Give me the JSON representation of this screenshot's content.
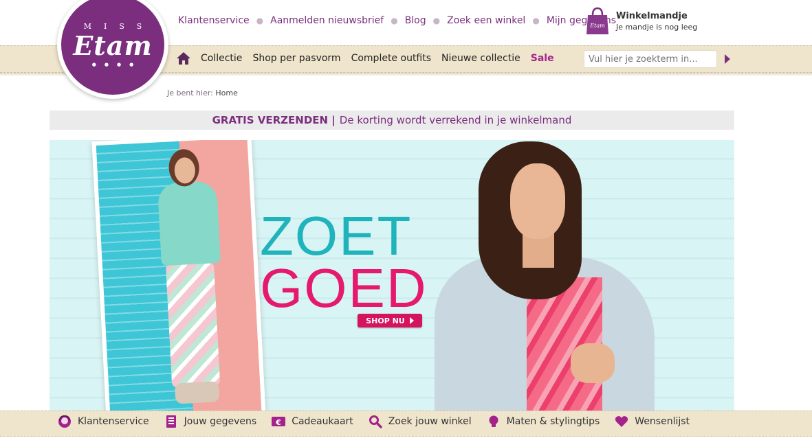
{
  "util_nav": [
    "Klantenservice",
    "Aanmelden nieuwsbrief",
    "Blog",
    "Zoek een winkel",
    "Mijn gegevens"
  ],
  "cart": {
    "title": "Winkelmandje",
    "status": "Je mandje is nog leeg",
    "bag_label": "Etam"
  },
  "logo": {
    "miss": "MISS",
    "brand": "Etam"
  },
  "main_nav": [
    "Collectie",
    "Shop per pasvorm",
    "Complete outfits",
    "Nieuwe collectie"
  ],
  "sale_label": "Sale",
  "search": {
    "placeholder": "Vul hier je zoekterm in..."
  },
  "breadcrumb": {
    "prefix": "Je bent hier:",
    "current": "Home"
  },
  "promo": {
    "strong": "GRATIS VERZENDEN |",
    "text": "De korting wordt verrekend in je winkelmand"
  },
  "hero": {
    "line1": "ZOET",
    "line2": "GOED",
    "cta": "SHOP NU"
  },
  "footer_nav": [
    {
      "label": "Klantenservice",
      "icon": "service-icon"
    },
    {
      "label": "Jouw gegevens",
      "icon": "document-icon"
    },
    {
      "label": "Cadeaukaart",
      "icon": "euro-card-icon"
    },
    {
      "label": "Zoek jouw winkel",
      "icon": "search-icon"
    },
    {
      "label": "Maten & stylingtips",
      "icon": "lightbulb-icon"
    },
    {
      "label": "Wensenlijst",
      "icon": "heart-icon"
    }
  ],
  "colors": {
    "brand_purple": "#7b2e7e",
    "sale_magenta": "#a3238b",
    "band_beige": "#efe4cc",
    "cta_pink": "#d4145f",
    "slogan_teal": "#1fb3bc",
    "slogan_pink": "#e5196d"
  }
}
